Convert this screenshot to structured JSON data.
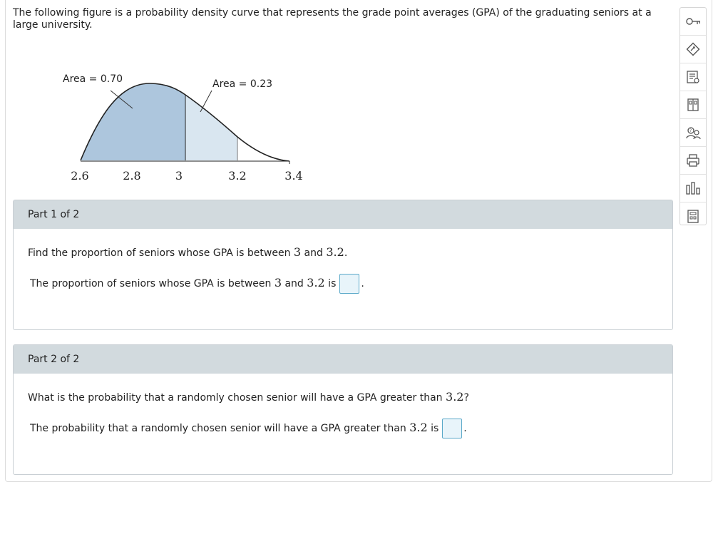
{
  "intro": "The following figure is a probability density curve that represents the grade point averages (GPA) of the graduating seniors at a large university.",
  "figure": {
    "area_left_label": "Area = 0.70",
    "area_right_label": "Area = 0.23",
    "ticks": [
      "2.6",
      "2.8",
      "3",
      "3.2",
      "3.4"
    ]
  },
  "part1": {
    "header": "Part 1 of 2",
    "question": {
      "pre": "Find the proportion of seniors whose GPA is between ",
      "a": "3",
      "mid": " and ",
      "b": "3.2",
      "post": "."
    },
    "answer": {
      "pre": "The proportion of seniors whose GPA is between ",
      "a": "3",
      "mid": " and ",
      "b": "3.2",
      "post": " is",
      "end": "."
    }
  },
  "part2": {
    "header": "Part 2 of 2",
    "question": {
      "pre": "What is the probability that a randomly chosen senior will have a GPA greater than ",
      "a": "3.2",
      "post": "?"
    },
    "answer": {
      "pre": "The probability that a randomly chosen senior will have a GPA greater than ",
      "a": "3.2",
      "post": " is",
      "end": "."
    }
  },
  "toolbar": [
    "key-icon",
    "pencil-diamond-icon",
    "checklist-icon",
    "textbook-icon",
    "help-people-icon",
    "print-icon",
    "bar-chart-icon",
    "calculator-icon"
  ],
  "colors": {
    "shade_main": "#adc6dd",
    "shade_light": "#d9e6f0",
    "answer_border": "#5ba9c9",
    "part_header": "#d2dade"
  }
}
